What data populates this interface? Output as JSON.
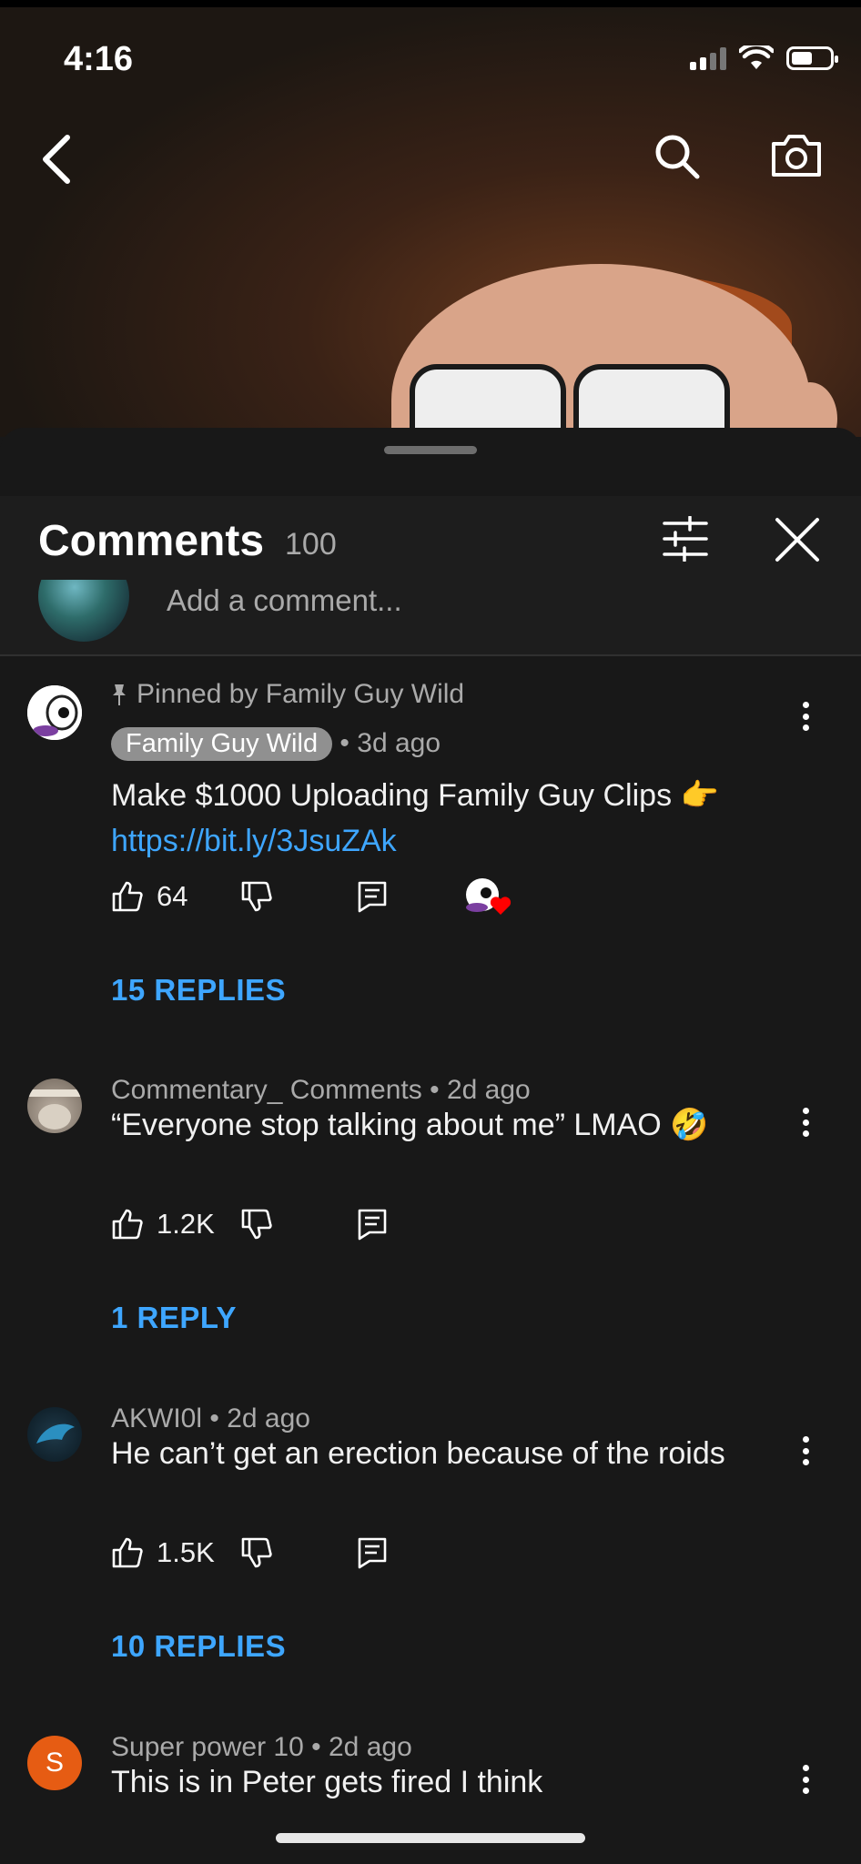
{
  "status_bar": {
    "time": "4:16"
  },
  "sheet": {
    "title": "Comments",
    "count": "100",
    "add_comment_placeholder": "Add a comment..."
  },
  "comments": [
    {
      "pinned_label": "Pinned by Family Guy Wild",
      "author": "Family Guy Wild",
      "age": "3d ago",
      "text": "Make $1000 Uploading Family Guy Clips 👉",
      "link": "https://bit.ly/3JsuZAk",
      "likes": "64",
      "replies": "15 REPLIES",
      "creator_hearted": true
    },
    {
      "author": "Commentary_ Comments",
      "age": "2d ago",
      "text": "“Everyone stop talking about me” LMAO 🤣",
      "likes": "1.2K",
      "replies": "1 REPLY"
    },
    {
      "author": "AKWI0l",
      "age": "2d ago",
      "text": "He can’t get an erection because of the roids",
      "likes": "1.5K",
      "replies": "10 REPLIES"
    },
    {
      "author": "Super power 10",
      "age": "2d ago",
      "avatar_letter": "S",
      "text": "This is in Peter gets fired I think"
    }
  ],
  "colors": {
    "accent_link": "#3ea6ff",
    "background": "#181818",
    "avatar_orange": "#e65c13",
    "heart": "#ff0000"
  }
}
